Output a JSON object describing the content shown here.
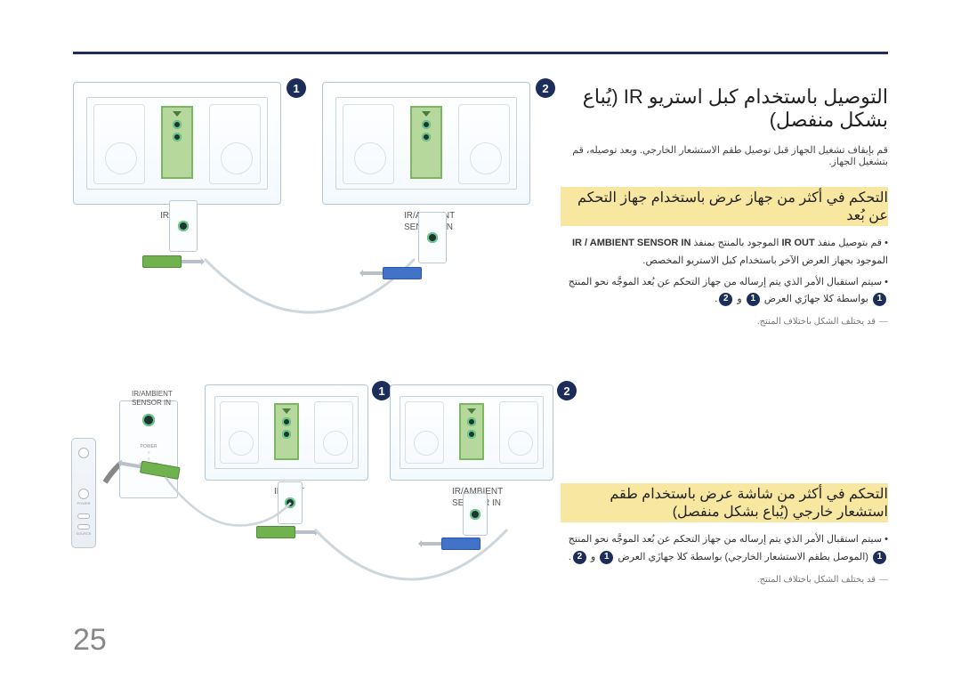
{
  "page_number": "25",
  "title": "التوصيل باستخدام كبل استريو IR (يُباع بشكل منفصل)",
  "intro": "قم بإيقاف تشغيل الجهاز قبل توصيل طقم الاستشعار الخارجي. وبعد توصيله، قم بتشغيل الجهاز.",
  "section1": {
    "heading": "التحكم في أكثر من جهاز عرض باستخدام جهاز التحكم عن بُعد",
    "bullet1_pre": "قم بتوصيل منفذ ",
    "bullet1_bold1": "IR OUT",
    "bullet1_mid": " الموجود بالمنتج بمنفذ ",
    "bullet1_bold2": "IR / AMBIENT SENSOR IN",
    "bullet1_post": " الموجود بجهاز العرض الآخر باستخدام كبل الاستريو المخصص.",
    "bullet2_pre": "سيتم استقبال الأمر الذي يتم إرساله من جهاز التحكم عن بُعد الموجَّه نحو المنتج ",
    "bullet2_mid": " بواسطة كلا جهازَي العرض ",
    "bullet2_and": " و ",
    "bullet2_end": ".",
    "note": "قد يختلف الشكل باختلاف المنتج."
  },
  "section2": {
    "heading": "التحكم في أكثر من شاشة عرض باستخدام طقم استشعار خارجي (يُباع بشكل منفصل)",
    "bullet_pre": "سيتم استقبال الأمر الذي يتم إرساله من جهاز التحكم عن بُعد الموجَّه نحو المنتج ",
    "bullet_mid": " (الموصل بطقم الاستشعار الخارجي) بواسطة كلا جهازَي العرض ",
    "bullet_and": " و ",
    "bullet_end": ".",
    "note": "قد يختلف الشكل باختلاف المنتج."
  },
  "labels": {
    "ir_out": "IR OUT",
    "ir_ambient_in": "IR/AMBIENT\nSENSOR IN",
    "power": "POWER",
    "source": "SOURCE",
    "badge1": "1",
    "badge2": "2"
  }
}
